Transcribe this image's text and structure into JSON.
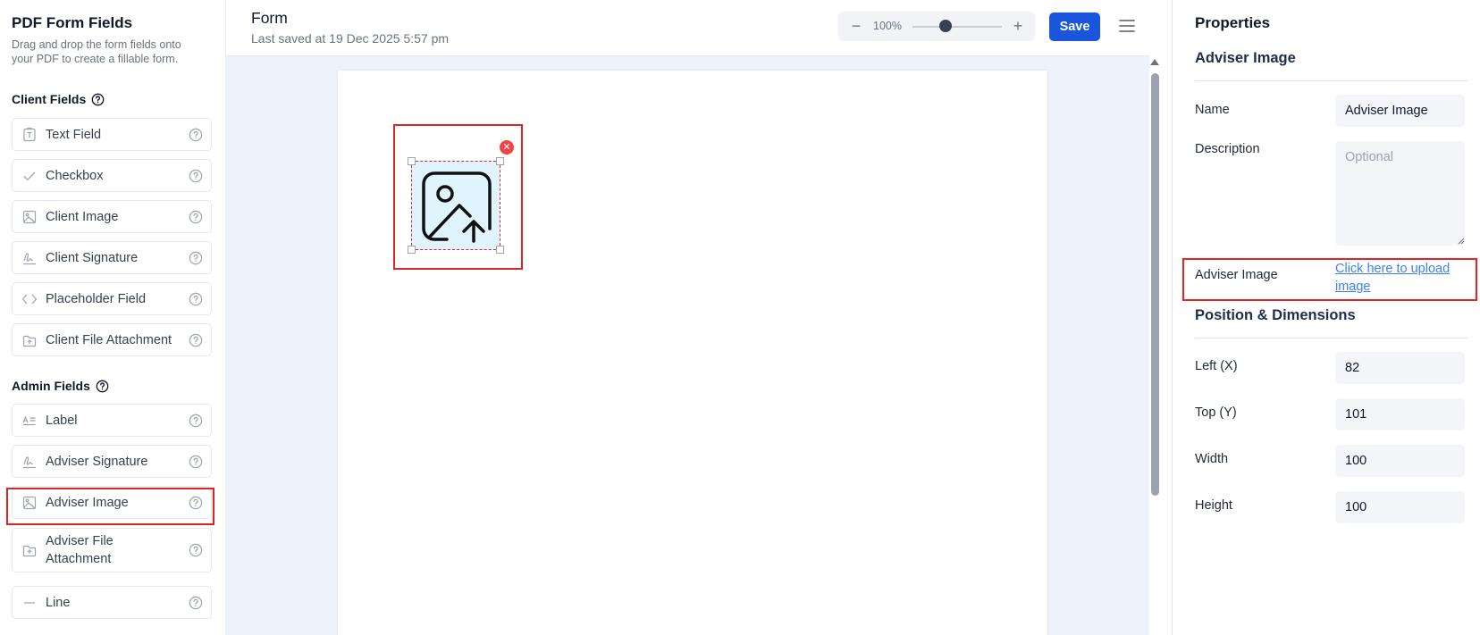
{
  "sidebar": {
    "title": "PDF Form Fields",
    "description": "Drag and drop the form fields onto your PDF to create a fillable form.",
    "client_section": "Client Fields",
    "admin_section": "Admin Fields",
    "client_fields": [
      {
        "label": "Text Field",
        "icon": "text-field-icon"
      },
      {
        "label": "Checkbox",
        "icon": "checkmark-icon"
      },
      {
        "label": "Client Image",
        "icon": "image-icon"
      },
      {
        "label": "Client Signature",
        "icon": "signature-icon"
      },
      {
        "label": "Placeholder Field",
        "icon": "code-brackets-icon"
      },
      {
        "label": "Client File Attachment",
        "icon": "upload-file-icon"
      }
    ],
    "admin_fields": [
      {
        "label": "Label",
        "icon": "label-icon"
      },
      {
        "label": "Adviser Signature",
        "icon": "signature-icon"
      },
      {
        "label": "Adviser Image",
        "icon": "image-icon"
      },
      {
        "label": "Adviser File Attachment",
        "icon": "upload-file-icon"
      },
      {
        "label": "Line",
        "icon": "line-icon"
      }
    ]
  },
  "header": {
    "title": "Form",
    "last_saved": "Last saved at 19 Dec 2025 5:57 pm",
    "zoom_level": "100%",
    "zoom_minus": "−",
    "zoom_plus": "+",
    "save_label": "Save"
  },
  "properties": {
    "title": "Properties",
    "subtitle": "Adviser Image",
    "name_label": "Name",
    "name_value": "Adviser Image",
    "description_label": "Description",
    "description_placeholder": "Optional",
    "image_label": "Adviser Image",
    "upload_link": "Click here to upload image",
    "position_title": "Position & Dimensions",
    "left_label": "Left (X)",
    "left_value": "82",
    "top_label": "Top (Y)",
    "top_value": "101",
    "width_label": "Width",
    "width_value": "100",
    "height_label": "Height",
    "height_value": "100"
  },
  "colors": {
    "accent": "#1a56db",
    "highlight": "#e02424",
    "link": "#3b82f6"
  }
}
